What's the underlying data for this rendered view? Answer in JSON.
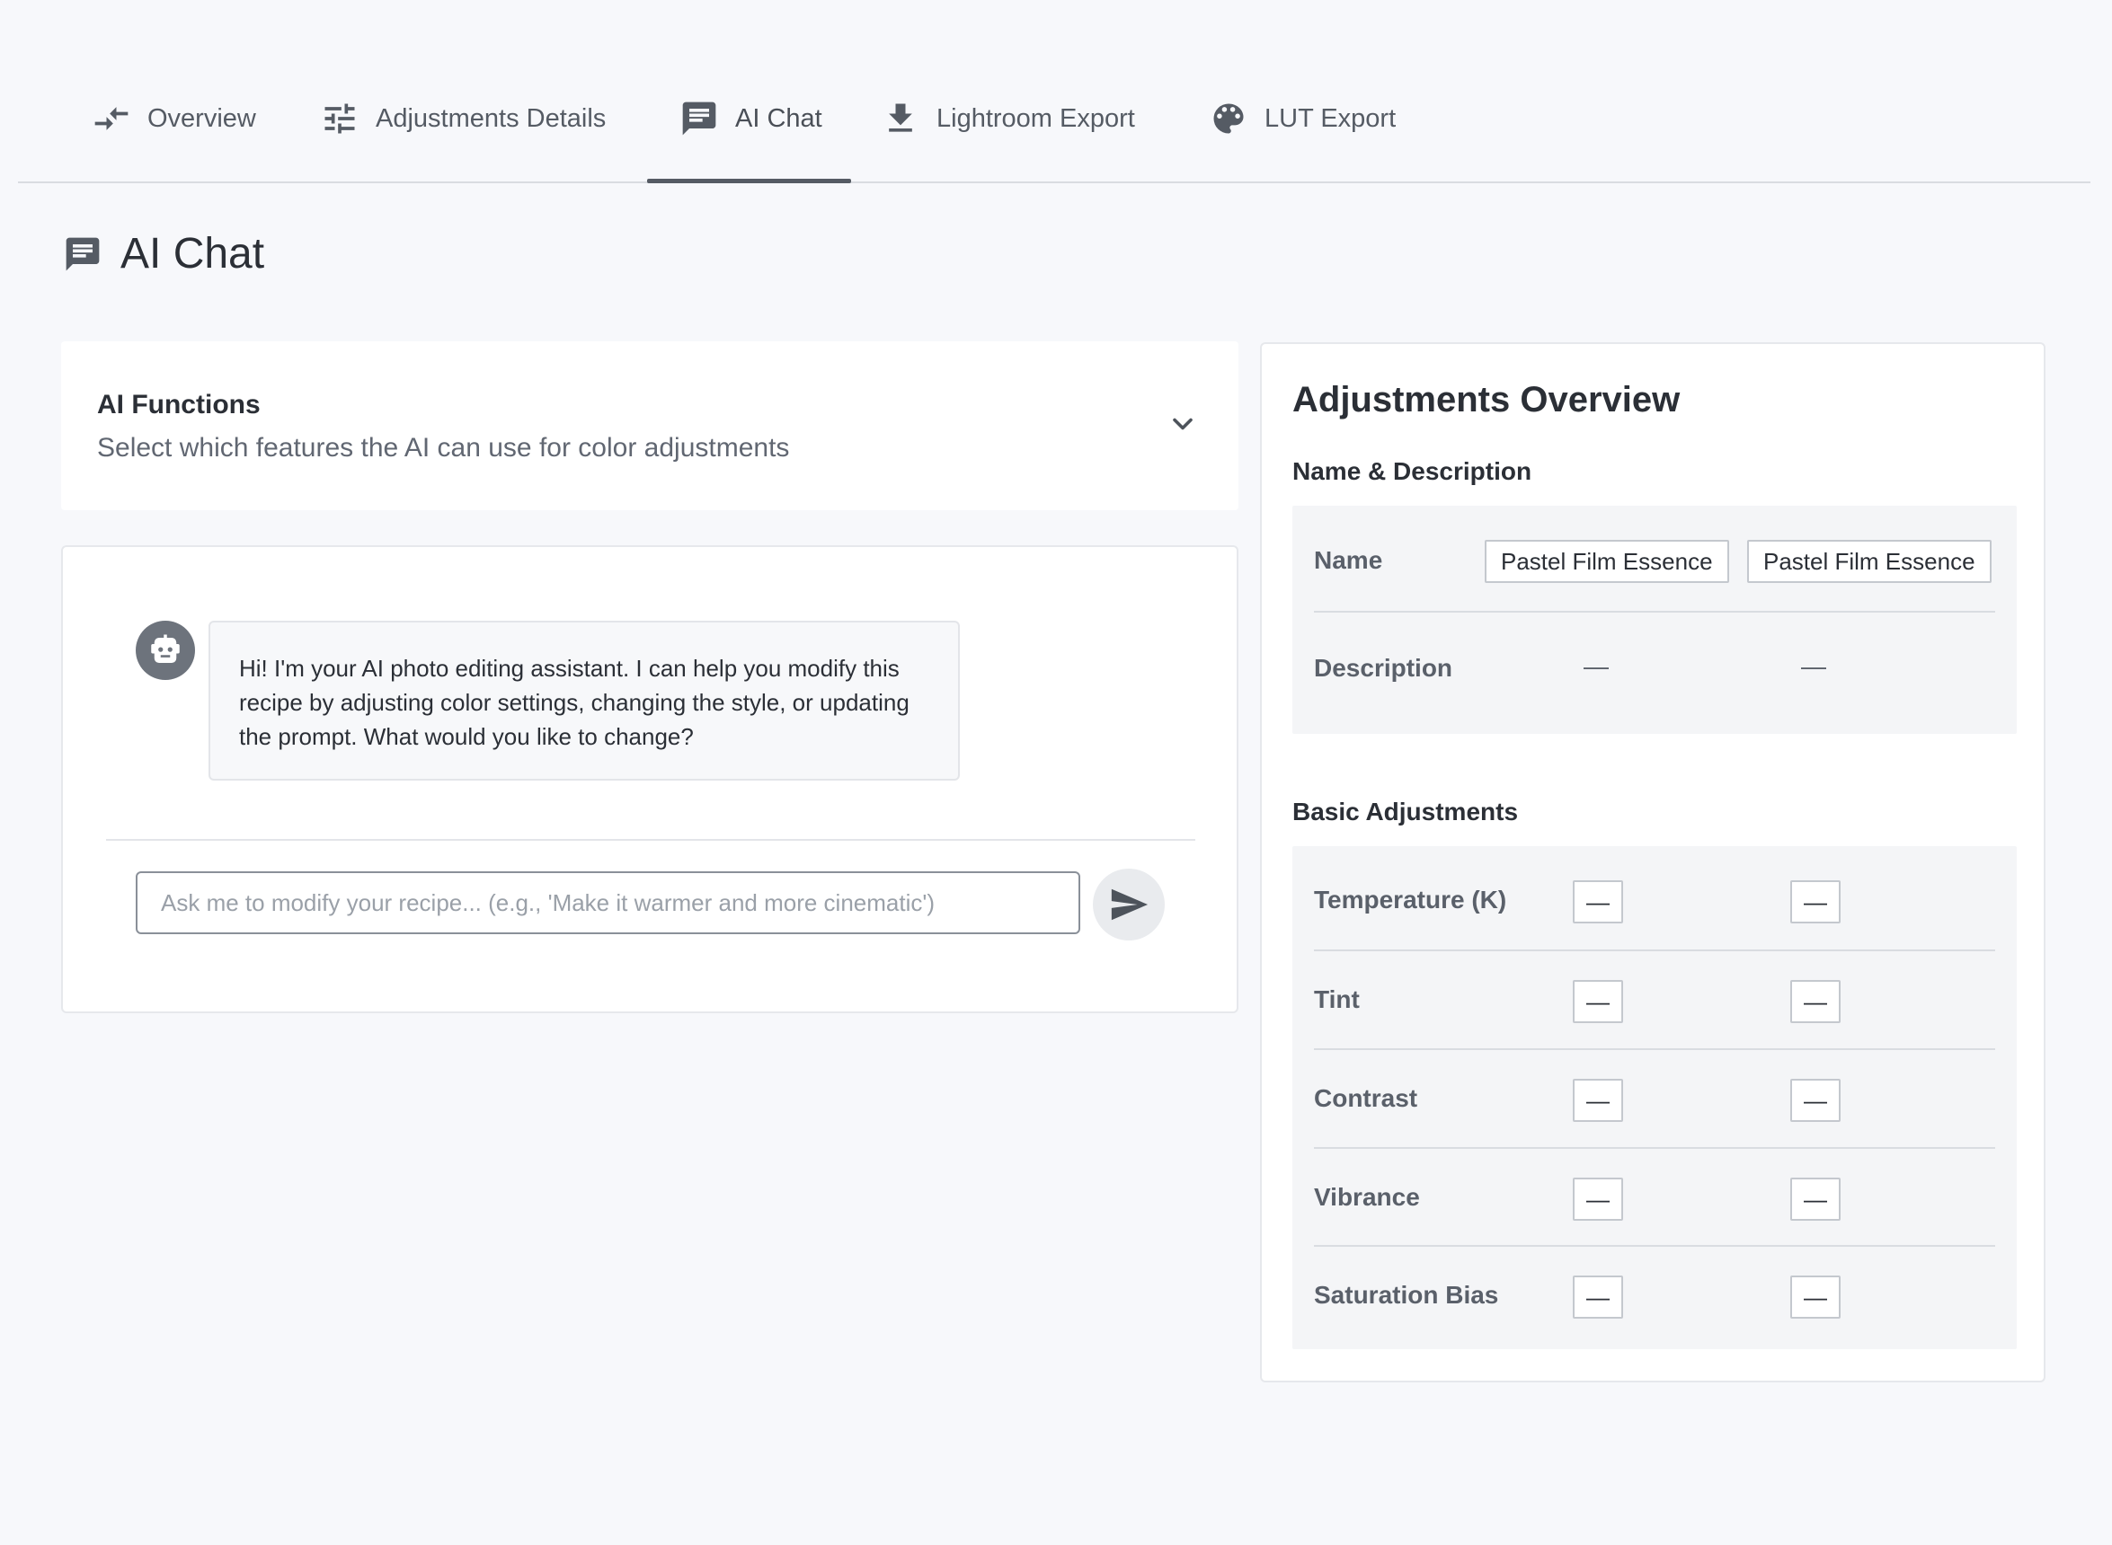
{
  "tabs": [
    {
      "label": "Overview",
      "icon": "compare-arrows-icon"
    },
    {
      "label": "Adjustments Details",
      "icon": "sliders-icon"
    },
    {
      "label": "AI Chat",
      "icon": "chat-icon",
      "active": true
    },
    {
      "label": "Lightroom Export",
      "icon": "download-icon"
    },
    {
      "label": "LUT Export",
      "icon": "palette-icon"
    }
  ],
  "page": {
    "title": "AI Chat",
    "icon": "chat-icon"
  },
  "ai_functions": {
    "title": "AI Functions",
    "subtitle": "Select which features the AI can use for color adjustments",
    "icon": "chevron-down-icon"
  },
  "chat": {
    "assistant_message": "Hi! I'm your AI photo editing assistant. I can help you modify this recipe by adjusting color settings, changing the style, or updating the prompt. What would you like to change?",
    "input_placeholder": "Ask me to modify your recipe... (e.g., 'Make it warmer and more cinematic')",
    "input_value": "",
    "avatar_icon": "robot-icon",
    "send_icon": "send-icon"
  },
  "adjustments": {
    "title": "Adjustments Overview",
    "name_section": {
      "title": "Name & Description",
      "rows": [
        {
          "label": "Name",
          "values": [
            "Pastel Film Essence",
            "Pastel Film Essence"
          ]
        },
        {
          "label": "Description",
          "values": [
            "—",
            "—"
          ]
        }
      ]
    },
    "basic_section": {
      "title": "Basic Adjustments",
      "rows": [
        {
          "label": "Temperature (K)",
          "values": [
            "—",
            "—"
          ]
        },
        {
          "label": "Tint",
          "values": [
            "—",
            "—"
          ]
        },
        {
          "label": "Contrast",
          "values": [
            "—",
            "—"
          ]
        },
        {
          "label": "Vibrance",
          "values": [
            "—",
            "—"
          ]
        },
        {
          "label": "Saturation Bias",
          "values": [
            "—",
            "—"
          ]
        }
      ]
    }
  }
}
